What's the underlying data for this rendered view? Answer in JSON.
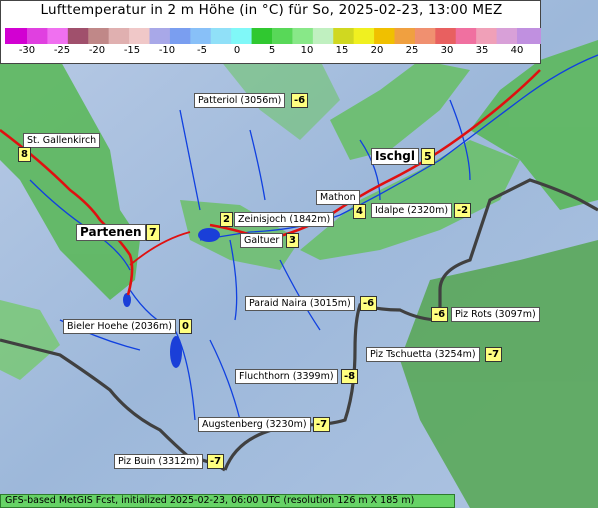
{
  "title": "Lufttemperatur in 2 m Höhe (in °C) für So, 2025-02-23, 13:00 MEZ",
  "scale": {
    "ticks": [
      "-30",
      "-25",
      "-20",
      "-15",
      "-10",
      "-5",
      "0",
      "5",
      "10",
      "15",
      "20",
      "25",
      "30",
      "35",
      "40"
    ],
    "colors": [
      "#d200d2",
      "#e040e0",
      "#f070f0",
      "#a0506c",
      "#c08888",
      "#e0b0b0",
      "#f0c8c8",
      "#a8a8e8",
      "#7a9ef0",
      "#88c0f8",
      "#90e0f8",
      "#80f8f8",
      "#30c830",
      "#58d858",
      "#88e888",
      "#c0f0c0",
      "#d0d820",
      "#f0f020",
      "#f0c000",
      "#f0a040",
      "#f09070",
      "#e86060",
      "#f070a0",
      "#f0a0b8",
      "#d8a0d8",
      "#c090e0"
    ]
  },
  "places": [
    {
      "name": "Patteriol (3056m)",
      "temp": "-6"
    },
    {
      "name": "St. Gallenkirch",
      "temp": "8"
    },
    {
      "name": "Ischgl",
      "temp": "5"
    },
    {
      "name": "Mathon",
      "temp": "4"
    },
    {
      "name": "Idalpe (2320m)",
      "temp": "-2"
    },
    {
      "name": "Zeinisjoch (1842m)",
      "temp": "2"
    },
    {
      "name": "Partenen",
      "temp": "7"
    },
    {
      "name": "Galtuer",
      "temp": "3"
    },
    {
      "name": "Paraid Naira (3015m)",
      "temp": "-6"
    },
    {
      "name": "Piz Rots (3097m)",
      "temp": "-6"
    },
    {
      "name": "Bieler Hoehe (2036m)",
      "temp": "0"
    },
    {
      "name": "Piz Tschuetta (3254m)",
      "temp": "-7"
    },
    {
      "name": "Fluchthorn (3399m)",
      "temp": "-8"
    },
    {
      "name": "Augstenberg (3230m)",
      "temp": "-7"
    },
    {
      "name": "Piz Buin (3312m)",
      "temp": "-7"
    }
  ],
  "footer": "GFS-based MetGIS Fcst, initialized 2025-02-23, 06:00 UTC  (resolution 126 m X 185 m)"
}
